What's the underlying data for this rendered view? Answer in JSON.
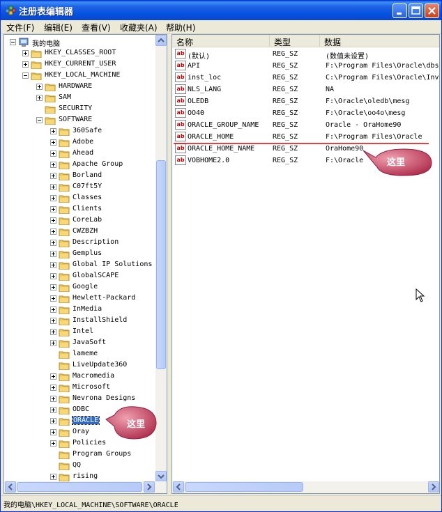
{
  "window": {
    "title": "注册表编辑器"
  },
  "menu": [
    "文件(F)",
    "编辑(E)",
    "查看(V)",
    "收藏夹(A)",
    "帮助(H)"
  ],
  "tree": {
    "root": "我的电脑",
    "nodes": [
      {
        "label": "我的电脑",
        "level": 0,
        "exp": "minus"
      },
      {
        "label": "HKEY_CLASSES_ROOT",
        "level": 1,
        "exp": "plus"
      },
      {
        "label": "HKEY_CURRENT_USER",
        "level": 1,
        "exp": "plus"
      },
      {
        "label": "HKEY_LOCAL_MACHINE",
        "level": 1,
        "exp": "minus"
      },
      {
        "label": "HARDWARE",
        "level": 2,
        "exp": "plus"
      },
      {
        "label": "SAM",
        "level": 2,
        "exp": "plus"
      },
      {
        "label": "SECURITY",
        "level": 2,
        "exp": "none"
      },
      {
        "label": "SOFTWARE",
        "level": 2,
        "exp": "minus"
      },
      {
        "label": "360Safe",
        "level": 3,
        "exp": "plus"
      },
      {
        "label": "Adobe",
        "level": 3,
        "exp": "plus"
      },
      {
        "label": "Ahead",
        "level": 3,
        "exp": "plus"
      },
      {
        "label": "Apache Group",
        "level": 3,
        "exp": "plus"
      },
      {
        "label": "Borland",
        "level": 3,
        "exp": "plus"
      },
      {
        "label": "C07ft5Y",
        "level": 3,
        "exp": "plus"
      },
      {
        "label": "Classes",
        "level": 3,
        "exp": "plus"
      },
      {
        "label": "Clients",
        "level": 3,
        "exp": "plus"
      },
      {
        "label": "CoreLab",
        "level": 3,
        "exp": "plus"
      },
      {
        "label": "CWZBZH",
        "level": 3,
        "exp": "plus"
      },
      {
        "label": "Description",
        "level": 3,
        "exp": "plus"
      },
      {
        "label": "Gemplus",
        "level": 3,
        "exp": "plus"
      },
      {
        "label": "Global IP Solutions",
        "level": 3,
        "exp": "plus"
      },
      {
        "label": "GlobalSCAPE",
        "level": 3,
        "exp": "plus"
      },
      {
        "label": "Google",
        "level": 3,
        "exp": "plus"
      },
      {
        "label": "Hewlett-Packard",
        "level": 3,
        "exp": "plus"
      },
      {
        "label": "InMedia",
        "level": 3,
        "exp": "plus"
      },
      {
        "label": "InstallShield",
        "level": 3,
        "exp": "plus"
      },
      {
        "label": "Intel",
        "level": 3,
        "exp": "plus"
      },
      {
        "label": "JavaSoft",
        "level": 3,
        "exp": "plus"
      },
      {
        "label": "lameme",
        "level": 3,
        "exp": "none"
      },
      {
        "label": "LiveUpdate360",
        "level": 3,
        "exp": "none"
      },
      {
        "label": "Macromedia",
        "level": 3,
        "exp": "plus"
      },
      {
        "label": "Microsoft",
        "level": 3,
        "exp": "plus"
      },
      {
        "label": "Nevrona Designs",
        "level": 3,
        "exp": "plus"
      },
      {
        "label": "ODBC",
        "level": 3,
        "exp": "plus"
      },
      {
        "label": "ORACLE",
        "level": 3,
        "exp": "plus",
        "selected": true
      },
      {
        "label": "Oray",
        "level": 3,
        "exp": "plus"
      },
      {
        "label": "Policies",
        "level": 3,
        "exp": "plus"
      },
      {
        "label": "Program Groups",
        "level": 3,
        "exp": "none"
      },
      {
        "label": "QQ",
        "level": 3,
        "exp": "none"
      },
      {
        "label": "rising",
        "level": 3,
        "exp": "plus"
      }
    ]
  },
  "list": {
    "columns": [
      "名称",
      "类型",
      "数据"
    ],
    "rows": [
      {
        "name": "(默认)",
        "type": "REG_SZ",
        "data": "(数值未设置)"
      },
      {
        "name": "API",
        "type": "REG_SZ",
        "data": "F:\\Program Files\\Oracle\\dbs"
      },
      {
        "name": "inst_loc",
        "type": "REG_SZ",
        "data": "C:\\Program Files\\Oracle\\Inv"
      },
      {
        "name": "NLS_LANG",
        "type": "REG_SZ",
        "data": "NA"
      },
      {
        "name": "OLEDB",
        "type": "REG_SZ",
        "data": "F:\\Oracle\\oledb\\mesg"
      },
      {
        "name": "OO40",
        "type": "REG_SZ",
        "data": "F:\\Oracle\\oo4o\\mesg"
      },
      {
        "name": "ORACLE_GROUP_NAME",
        "type": "REG_SZ",
        "data": "Oracle - OraHome90"
      },
      {
        "name": "ORACLE_HOME",
        "type": "REG_SZ",
        "data": "F:\\Program Files\\Oracle"
      },
      {
        "name": "ORACLE_HOME_NAME",
        "type": "REG_SZ",
        "data": "OraHome90"
      },
      {
        "name": "VOBHOME2.0",
        "type": "REG_SZ",
        "data": "F:\\Oracle"
      }
    ],
    "ab_label": "ab"
  },
  "callouts": {
    "list": "这里",
    "tree": "这里"
  },
  "status": {
    "path": "我的电脑\\HKEY_LOCAL_MACHINE\\SOFTWARE\\ORACLE"
  },
  "colors": {
    "titlebar": "#0a5ee0",
    "selection": "#316ac5",
    "underline": "#e00000",
    "callout": "#c8506a"
  }
}
